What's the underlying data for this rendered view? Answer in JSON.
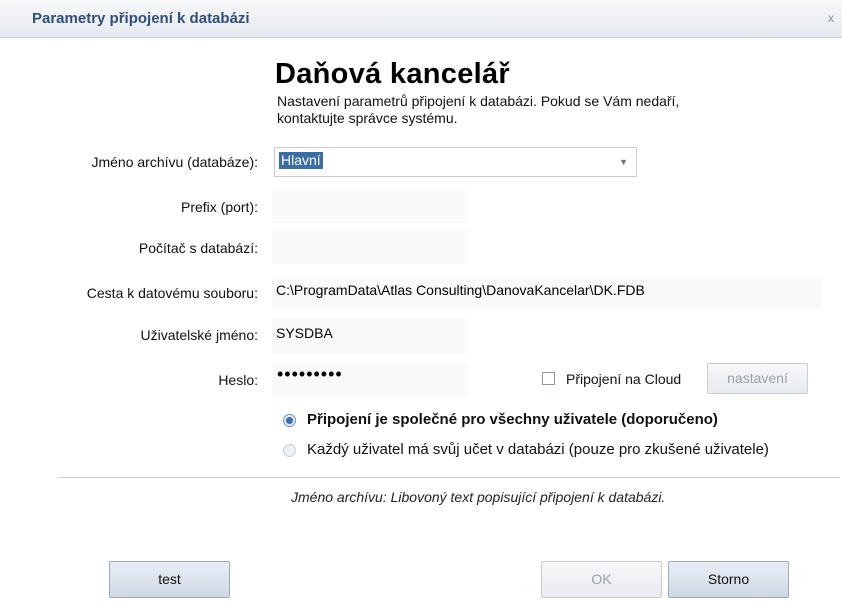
{
  "window": {
    "title": "Parametry připojení k databázi",
    "close_glyph": "x"
  },
  "header": {
    "heading": "Daňová kancelář",
    "description": "Nastavení parametrů připojení k databázi. Pokud se Vám nedaří, kontaktujte správce systému."
  },
  "form": {
    "archive": {
      "label": "Jméno archívu (databáze):",
      "value": "Hlavní"
    },
    "prefix": {
      "label": "Prefix (port):",
      "value": ""
    },
    "host": {
      "label": "Počítač s databází:",
      "value": ""
    },
    "path": {
      "label": "Cesta k datovému souboru:",
      "value": "C:\\ProgramData\\Atlas Consulting\\DanovaKancelar\\DK.FDB"
    },
    "user": {
      "label": "Uživatelské jméno:",
      "value": "SYSDBA"
    },
    "password": {
      "label": "Heslo:",
      "masked": "•••••••••"
    },
    "cloud": {
      "label": "Připojení na Cloud",
      "checked": false,
      "settings_button": "nastavení"
    }
  },
  "radios": [
    {
      "label": "Připojení je společné pro všechny uživatele (doporučeno)",
      "selected": true
    },
    {
      "label": "Každý uživatel má svůj učet v databázi (pouze pro zkušené uživatele)",
      "selected": false
    }
  ],
  "hint": "Jméno archívu: Libovoný text popisující připojení k databázi.",
  "buttons": {
    "test": "test",
    "ok": "OK",
    "cancel": "Storno"
  }
}
